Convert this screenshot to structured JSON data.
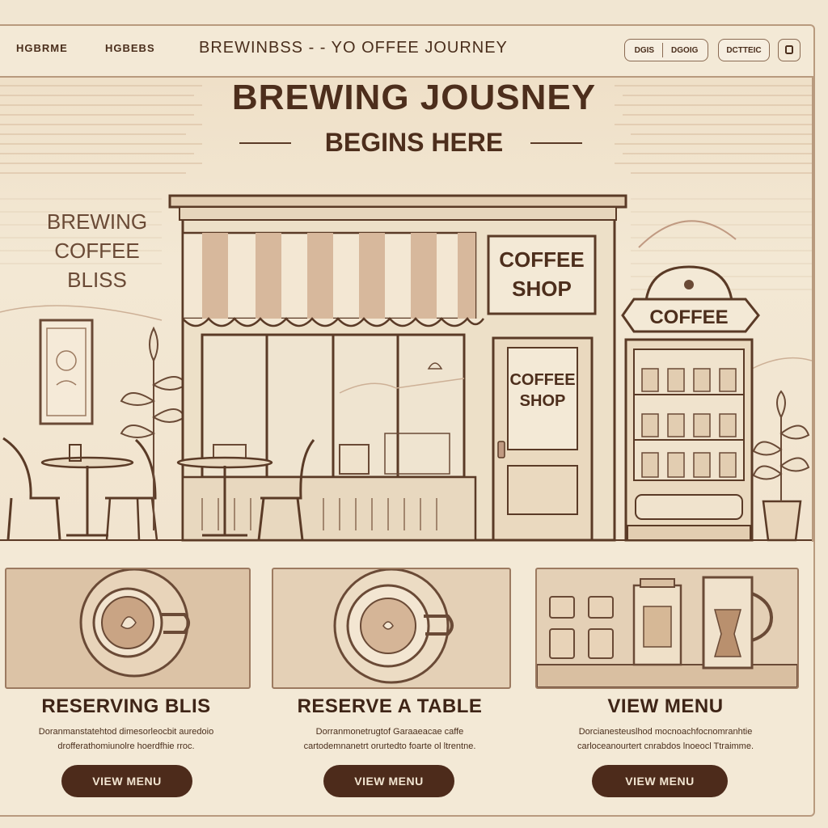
{
  "nav": {
    "links": [
      "HGBRME",
      "HGBEBS"
    ],
    "brand": "BREWINBSS - -  YO OFFEE JOURNEY",
    "pill_left": "DGIS",
    "pill_right": "DGOIG",
    "pill_single": "DCTTEIC"
  },
  "hero": {
    "title": "BREWING JOUSNEY",
    "subtitle": "BEGINS HERE",
    "side_text": [
      "BREWING",
      "COFFEE",
      "BLISS"
    ],
    "shop_sign": [
      "COFFEE",
      "SHOP"
    ],
    "door_sign": [
      "COFFEE",
      "SHOP"
    ],
    "kiosk_sign": "COFFEE"
  },
  "cards": [
    {
      "title": "RESERVING BLIS",
      "desc": [
        "Doranmanstatehtod dimesorleocbit auredoio",
        "drofferathomiunolre hoerdfhie rroc."
      ],
      "button": "VIEW MENU"
    },
    {
      "title": "RESERVE A TABLE",
      "desc": [
        "Dorranmonetrugtof Garaaeacae caffe",
        "cartodemnanetrt orurtedto foarte ol ltrentne."
      ],
      "button": "VIEW MENU"
    },
    {
      "title": "VIEW MENU",
      "desc": [
        "Dorcianesteuslhod mocnoachfocnomranhtie",
        "carloceanourtert cnrabdos lnoeocl Ttraimme."
      ],
      "button": "VIEW MENU"
    }
  ],
  "colors": {
    "background": "#f1e6d2",
    "ink": "#4d2e1c",
    "button": "#4d2b1b",
    "border": "#9c7a60"
  }
}
